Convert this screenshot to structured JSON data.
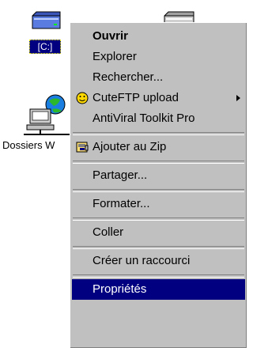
{
  "desktop": {
    "drive_c_label": "[C:]",
    "network_label": "Dossiers W"
  },
  "menu": {
    "items": [
      {
        "label": "Ouvrir"
      },
      {
        "label": "Explorer"
      },
      {
        "label": "Rechercher..."
      },
      {
        "label": "CuteFTP upload"
      },
      {
        "label": "AntiViral Toolkit Pro"
      },
      {
        "label": "Ajouter au Zip"
      },
      {
        "label": "Partager..."
      },
      {
        "label": "Formater..."
      },
      {
        "label": "Coller"
      },
      {
        "label": "Créer un raccourci"
      },
      {
        "label": "Propriétés"
      }
    ]
  },
  "colors": {
    "menu_bg": "#c0c0c0",
    "selection": "#000080"
  },
  "icons": {
    "drive": "drive-icon",
    "network": "network-neighborhood-icon",
    "cuteftp": "cuteftp-icon",
    "winzip": "winzip-icon"
  }
}
